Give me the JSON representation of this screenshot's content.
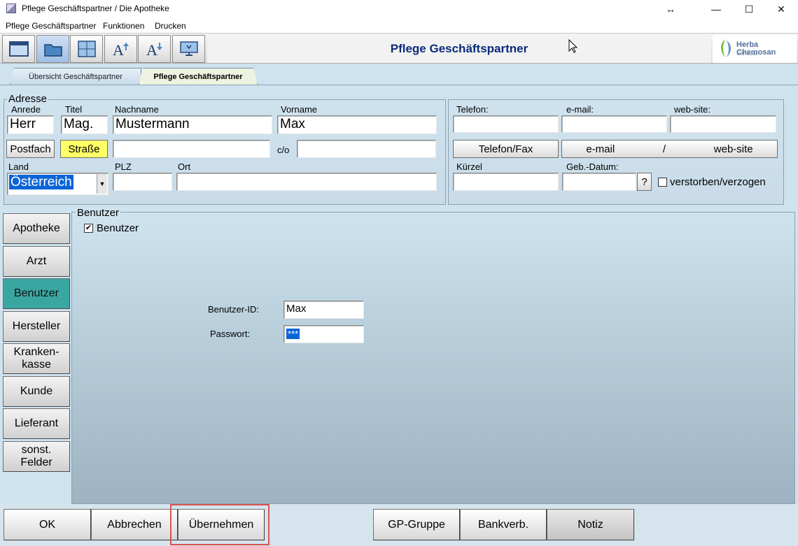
{
  "window": {
    "title": "Pflege Geschäftspartner  / Die Apotheke",
    "controls": {
      "resize": "↔",
      "minimize": "—",
      "maximize": "☐",
      "close": "✕"
    }
  },
  "menu": [
    "Pflege Geschäftspartner",
    "Funktionen",
    "Drucken"
  ],
  "toolbar": {
    "title": "Pflege Geschäftspartner",
    "logo": {
      "name": "Herba Chemosan",
      "sub": "Sanodat"
    }
  },
  "tabs": [
    "Übersicht Geschäftspartner",
    "Pflege Geschäftspartner"
  ],
  "address": {
    "legend": "Adresse",
    "anrede": {
      "label": "Anrede",
      "value": "Herr"
    },
    "titel": {
      "label": "Titel",
      "value": "Mag."
    },
    "nachname": {
      "label": "Nachname",
      "value": "Mustermann"
    },
    "vorname": {
      "label": "Vorname",
      "value": "Max"
    },
    "postfach_label": "Postfach",
    "strasse_label": "Straße",
    "strasse_value": "",
    "co_label": "c/o",
    "co_value": "",
    "land": {
      "label": "Land",
      "value": "Österreich"
    },
    "plz": {
      "label": "PLZ",
      "value": ""
    },
    "ort": {
      "label": "Ort",
      "value": ""
    }
  },
  "contact": {
    "telefon_label": "Telefon:",
    "email_label": "e-mail:",
    "website_label": "web-site:",
    "telefon_fax_button": "Telefon/Fax",
    "email_button": "e-mail",
    "slash": "/",
    "website_button": "web-site",
    "kuerzel_label": "Kürzel",
    "gebdatum_label": "Geb.-Datum:",
    "question_button": "?",
    "verstorben_label": "verstorben/verzogen"
  },
  "side_nav": [
    "Apotheke",
    "Arzt",
    "Benutzer",
    "Hersteller",
    "Kranken-\nkasse",
    "Kunde",
    "Lieferant",
    "sonst.\nFelder"
  ],
  "benutzer": {
    "legend": "Benutzer",
    "checkbox_label": "Benutzer",
    "checked": true,
    "id_label": "Benutzer-ID:",
    "id_value": "Max",
    "password_label": "Passwort:",
    "password_value": "***"
  },
  "bottom_buttons": {
    "ok": "OK",
    "abbrechen": "Abbrechen",
    "uebernehmen": "Übernehmen",
    "gp_gruppe": "GP-Gruppe",
    "bankverb": "Bankverb.",
    "notiz": "Notiz"
  },
  "colors": {
    "highlight": "#d9534f",
    "active_nav": "#3aa6a2",
    "title_blue": "#0b2a7a"
  }
}
